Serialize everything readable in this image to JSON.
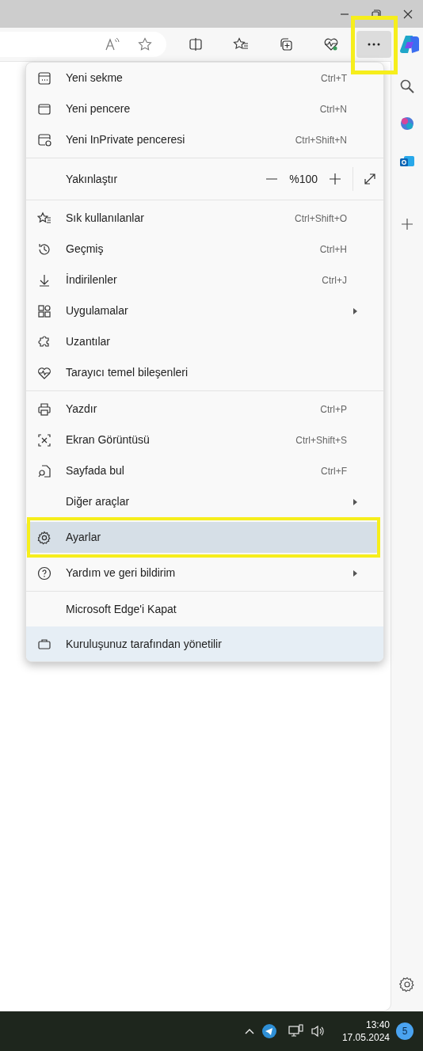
{
  "toolbar": {
    "more_button": {
      "highlighted": true
    }
  },
  "menu": {
    "items": [
      {
        "kind": "item",
        "label": "Yeni sekme",
        "shortcut": "Ctrl+T",
        "submenu": false,
        "selected": false,
        "highlighted": false
      },
      {
        "kind": "item",
        "label": "Yeni pencere",
        "shortcut": "Ctrl+N",
        "submenu": false,
        "selected": false,
        "highlighted": false
      },
      {
        "kind": "item",
        "label": "Yeni InPrivate penceresi",
        "shortcut": "Ctrl+Shift+N",
        "submenu": false,
        "selected": false,
        "highlighted": false
      },
      {
        "kind": "divider"
      },
      {
        "kind": "zoom",
        "label": "Yakınlaştır",
        "value": "%100"
      },
      {
        "kind": "divider"
      },
      {
        "kind": "item",
        "label": "Sık kullanılanlar",
        "shortcut": "Ctrl+Shift+O",
        "submenu": false,
        "selected": false,
        "highlighted": false
      },
      {
        "kind": "item",
        "label": "Geçmiş",
        "shortcut": "Ctrl+H",
        "submenu": false,
        "selected": false,
        "highlighted": false
      },
      {
        "kind": "item",
        "label": "İndirilenler",
        "shortcut": "Ctrl+J",
        "submenu": false,
        "selected": false,
        "highlighted": false
      },
      {
        "kind": "item",
        "label": "Uygulamalar",
        "submenu": true,
        "selected": false,
        "highlighted": false
      },
      {
        "kind": "item",
        "label": "Uzantılar",
        "submenu": false,
        "selected": false,
        "highlighted": false
      },
      {
        "kind": "item",
        "label": "Tarayıcı temel bileşenleri",
        "submenu": false,
        "selected": false,
        "highlighted": false
      },
      {
        "kind": "divider"
      },
      {
        "kind": "item",
        "label": "Yazdır",
        "shortcut": "Ctrl+P",
        "submenu": false,
        "selected": false,
        "highlighted": false
      },
      {
        "kind": "item",
        "label": "Ekran Görüntüsü",
        "shortcut": "Ctrl+Shift+S",
        "submenu": false,
        "selected": false,
        "highlighted": false
      },
      {
        "kind": "item",
        "label": "Sayfada bul",
        "shortcut": "Ctrl+F",
        "submenu": false,
        "selected": false,
        "highlighted": false
      },
      {
        "kind": "item",
        "label": "Diğer araçlar",
        "submenu": true,
        "selected": false,
        "highlighted": false
      },
      {
        "kind": "item",
        "label": "Ayarlar",
        "submenu": false,
        "selected": true,
        "highlighted": true
      },
      {
        "kind": "item",
        "label": "Yardım ve geri bildirim",
        "submenu": true,
        "selected": false,
        "highlighted": false
      },
      {
        "kind": "divider"
      },
      {
        "kind": "item",
        "label": "Microsoft Edge'i Kapat",
        "submenu": false,
        "selected": false,
        "highlighted": false
      },
      {
        "kind": "managed",
        "label": "Kuruluşunuz tarafından yönetilir"
      }
    ]
  },
  "taskbar": {
    "time": "13:40",
    "date": "17.05.2024",
    "notifications": "5"
  }
}
